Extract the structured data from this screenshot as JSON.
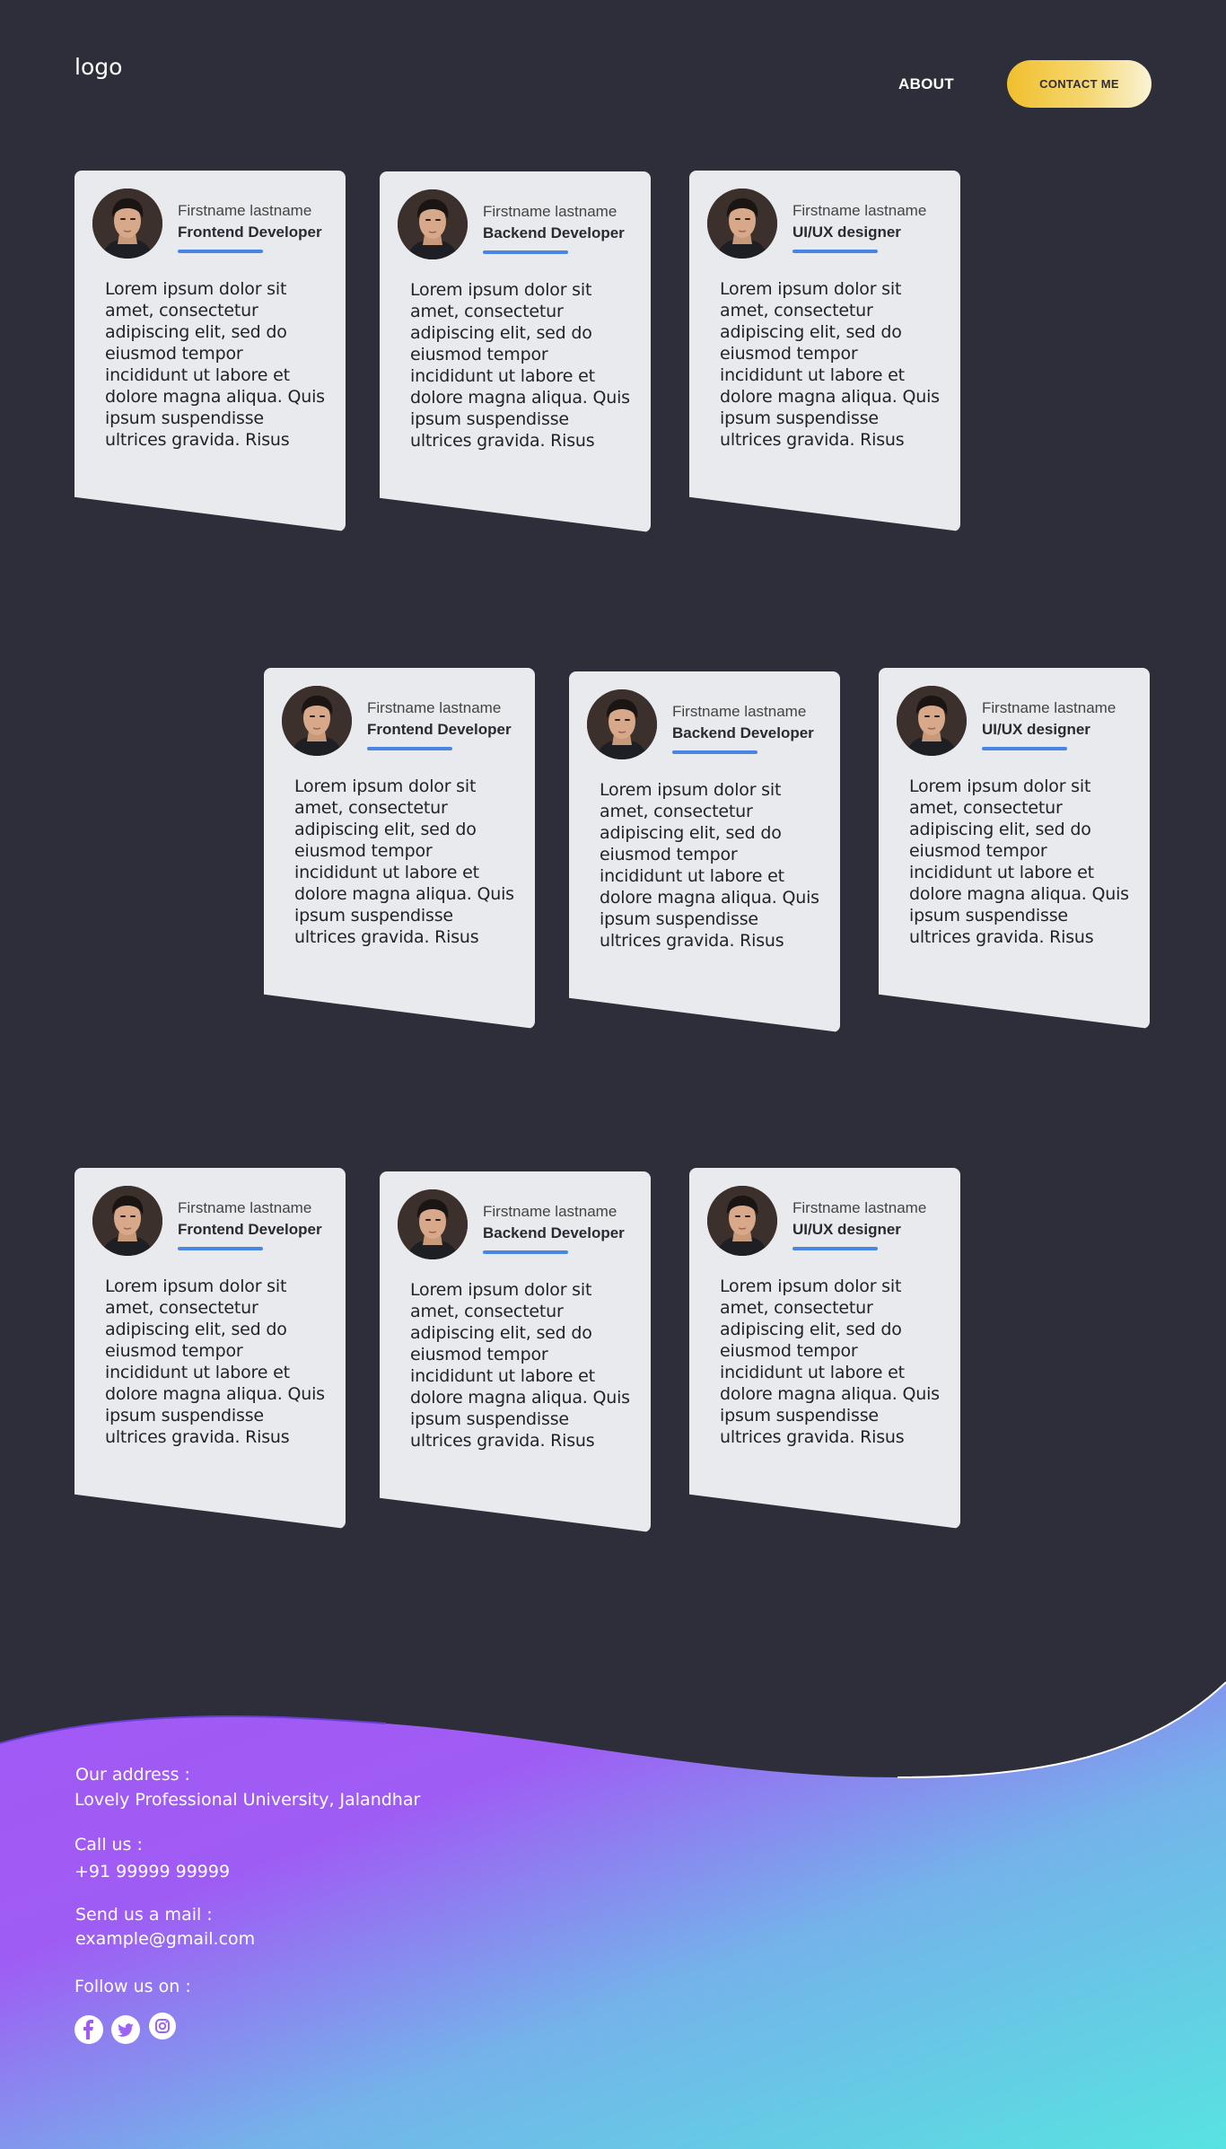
{
  "header": {
    "logo": "logo",
    "nav_about": "ABOUT",
    "contact_button": "CONTACT ME"
  },
  "cards": [
    {
      "name": "Firstname lastname",
      "role": "Frontend Developer",
      "bio": "Lorem ipsum dolor sit amet, consectetur adipiscing elit, sed do eiusmod tempor incididunt ut labore et dolore magna aliqua. Quis ipsum suspendisse ultrices gravida. Risus"
    },
    {
      "name": "Firstname lastname",
      "role": "Backend Developer",
      "bio": "Lorem ipsum dolor sit amet, consectetur adipiscing elit, sed do eiusmod tempor incididunt ut labore et dolore magna aliqua. Quis ipsum suspendisse ultrices gravida. Risus"
    },
    {
      "name": "Firstname lastname",
      "role": "UI/UX designer",
      "bio": "Lorem ipsum dolor sit amet, consectetur adipiscing elit, sed do eiusmod tempor incididunt ut labore et dolore magna aliqua. Quis ipsum suspendisse ultrices gravida. Risus"
    },
    {
      "name": "Firstname lastname",
      "role": "Frontend Developer",
      "bio": "Lorem ipsum dolor sit amet, consectetur adipiscing elit, sed do eiusmod tempor incididunt ut labore et dolore magna aliqua. Quis ipsum suspendisse ultrices gravida. Risus"
    },
    {
      "name": "Firstname lastname",
      "role": "Backend Developer",
      "bio": "Lorem ipsum dolor sit amet, consectetur adipiscing elit, sed do eiusmod tempor incididunt ut labore et dolore magna aliqua. Quis ipsum suspendisse ultrices gravida. Risus"
    },
    {
      "name": "Firstname lastname",
      "role": "UI/UX designer",
      "bio": "Lorem ipsum dolor sit amet, consectetur adipiscing elit, sed do eiusmod tempor incididunt ut labore et dolore magna aliqua. Quis ipsum suspendisse ultrices gravida. Risus"
    },
    {
      "name": "Firstname lastname",
      "role": "Frontend Developer",
      "bio": "Lorem ipsum dolor sit amet, consectetur adipiscing elit, sed do eiusmod tempor incididunt ut labore et dolore magna aliqua. Quis ipsum suspendisse ultrices gravida. Risus"
    },
    {
      "name": "Firstname lastname",
      "role": "Backend Developer",
      "bio": "Lorem ipsum dolor sit amet, consectetur adipiscing elit, sed do eiusmod tempor incididunt ut labore et dolore magna aliqua. Quis ipsum suspendisse ultrices gravida. Risus"
    },
    {
      "name": "Firstname lastname",
      "role": "UI/UX designer",
      "bio": "Lorem ipsum dolor sit amet, consectetur adipiscing elit, sed do eiusmod tempor incididunt ut labore et dolore magna aliqua. Quis ipsum suspendisse ultrices gravida. Risus"
    }
  ],
  "footer": {
    "address_label": "Our address :",
    "address_value": "Lovely Professional University, Jalandhar",
    "call_label": "Call us :",
    "call_value": "+91 99999 99999",
    "mail_label": "Send us a mail :",
    "mail_value": "example@gmail.com",
    "follow_label": "Follow us on :",
    "social_icons": [
      "facebook-icon",
      "twitter-icon",
      "instagram-icon"
    ]
  },
  "colors": {
    "background": "#2e2e3a",
    "card": "#e9eaee",
    "accent_underline": "#4a86e0",
    "button_gradient": [
      "#f1bf2e",
      "#faf3d6"
    ],
    "footer_gradient": [
      "#a259f5",
      "#57e3e0"
    ]
  }
}
